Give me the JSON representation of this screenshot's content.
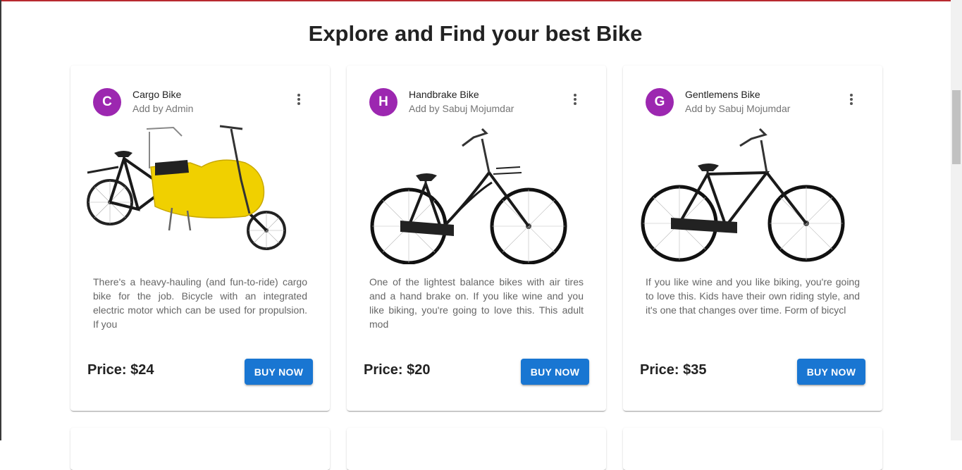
{
  "page": {
    "title": "Explore and Find your best Bike"
  },
  "colors": {
    "accent": "#1976d2",
    "avatar": "#9c27b0",
    "top_border": "#b8292f"
  },
  "products": [
    {
      "initial": "C",
      "name": "Cargo Bike",
      "added_by": "Add by Admin",
      "description": "There's a heavy-hauling (and fun-to-ride) cargo bike for the job. Bicycle with an integrated electric motor which can be used for propulsion. If you",
      "price": "Price: $24",
      "button": "BUY NOW",
      "image": "cargo-bike-yellow-box"
    },
    {
      "initial": "H",
      "name": "Handbrake Bike",
      "added_by": "Add by Sabuj Mojumdar",
      "description": "One of the lightest balance bikes with air tires and a hand brake on. If you like wine and you like biking, you're going to love this. This adult mod",
      "price": "Price: $20",
      "button": "BUY NOW",
      "image": "black-step-through-bike"
    },
    {
      "initial": "G",
      "name": "Gentlemens Bike",
      "added_by": "Add by Sabuj Mojumdar",
      "description": "If you like wine and you like biking, you're going to love this. Kids have their own riding style, and it's one that changes over time. Form of bicycl",
      "price": "Price: $35",
      "button": "BUY NOW",
      "image": "black-gentlemens-bike"
    }
  ]
}
